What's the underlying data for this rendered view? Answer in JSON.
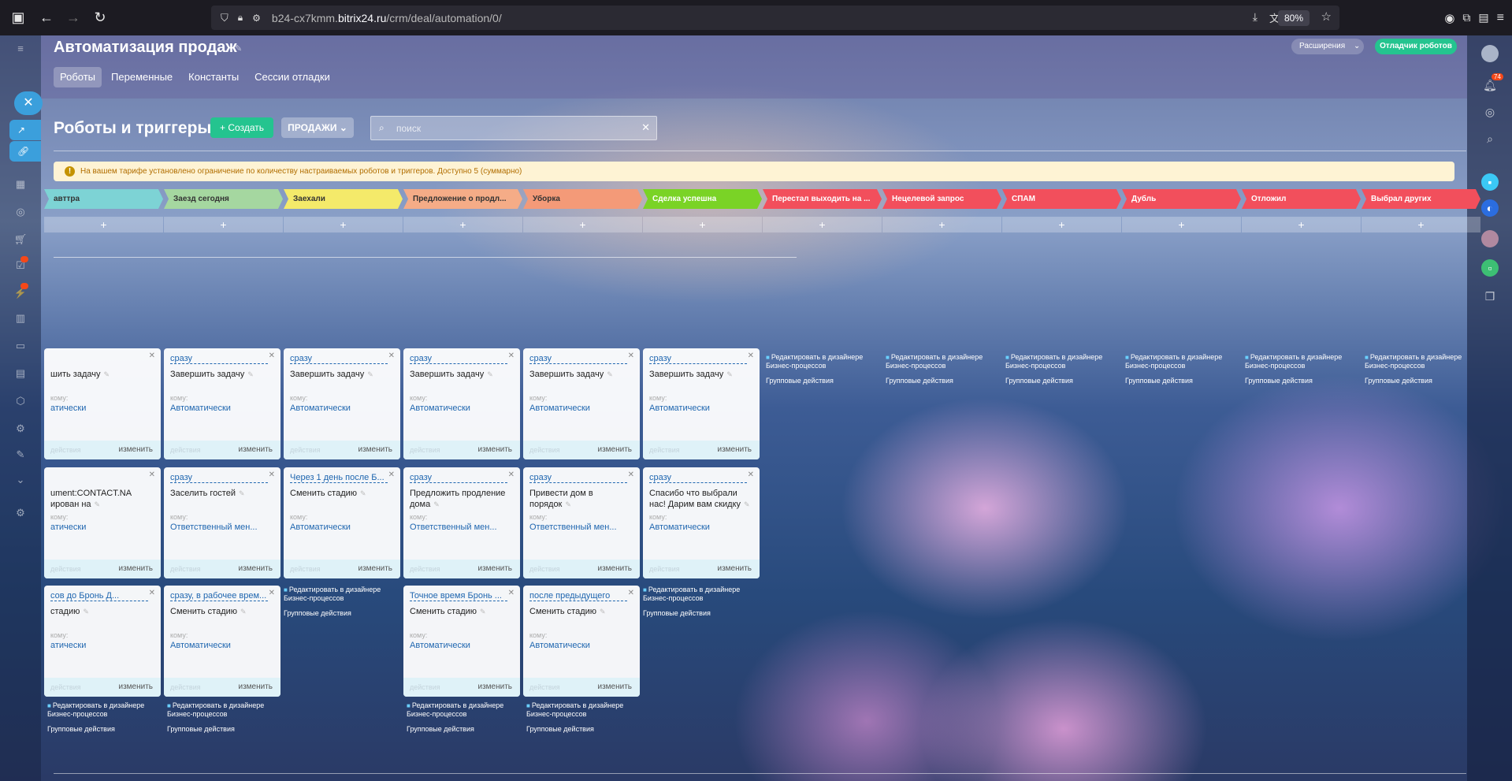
{
  "browser": {
    "url_prefix": "b24-cx7kmm.",
    "url_domain": "bitrix24.ru",
    "url_path": "/crm/deal/automation/0/",
    "zoom": "80%"
  },
  "page": {
    "title": "Автоматизация продаж",
    "extensions_label": "Расширения",
    "debugger_label": "Отладчик роботов",
    "tabs": [
      {
        "label": "Роботы",
        "active": true
      },
      {
        "label": "Переменные",
        "active": false
      },
      {
        "label": "Константы",
        "active": false
      },
      {
        "label": "Сессии отладки",
        "active": false
      }
    ],
    "section_title": "Роботы и триггеры",
    "create_label": "Создать",
    "category_label": "ПРОДАЖИ",
    "search_placeholder": "поиск",
    "notice_text": "На вашем тарифе установлено ограничение по количеству настраиваемых роботов и триггеров. Доступно 5 (суммарно)",
    "right_rail_badge": "74"
  },
  "stages": [
    {
      "label": "авттра",
      "color": "#7dd3d5"
    },
    {
      "label": "Заезд сегодня",
      "color": "#a5d7a0"
    },
    {
      "label": "Заехали",
      "color": "#f4ea6a"
    },
    {
      "label": "Предложение о продл...",
      "color": "#f5ac87"
    },
    {
      "label": "Уборка",
      "color": "#f49a78"
    },
    {
      "label": "Сделка успешна",
      "color": "#7ad326"
    },
    {
      "label": "Перестал выходить на ...",
      "color": "#f24f5c"
    },
    {
      "label": "Нецелевой запрос",
      "color": "#f24f5c"
    },
    {
      "label": "СПАМ",
      "color": "#f24f5c"
    },
    {
      "label": "Дубль",
      "color": "#f24f5c"
    },
    {
      "label": "Отложил",
      "color": "#f24f5c"
    },
    {
      "label": "Выбрал других",
      "color": "#f24f5c"
    }
  ],
  "card_labels": {
    "whom": "кому:",
    "actions": "действия",
    "edit": "изменить",
    "bp_link_1": "Редактировать в дизайнере",
    "bp_link_2": "Бизнес-процессов",
    "group_actions": "Групповые действия"
  },
  "rows": [
    [
      {
        "when": "",
        "title": "шить задачу",
        "resp": "атически"
      },
      {
        "when": "сразу",
        "title": "Завершить задачу",
        "resp": "Автоматически"
      },
      {
        "when": "сразу",
        "title": "Завершить задачу",
        "resp": "Автоматически"
      },
      {
        "when": "сразу",
        "title": "Завершить задачу",
        "resp": "Автоматически"
      },
      {
        "when": "сразу",
        "title": "Завершить задачу",
        "resp": "Автоматически"
      },
      {
        "when": "сразу",
        "title": "Завершить задачу",
        "resp": "Автоматически"
      }
    ],
    [
      {
        "when": "",
        "title": "ument:CONTACT.NA ирован на",
        "resp": "атически"
      },
      {
        "when": "сразу",
        "title": "Заселить гостей",
        "resp": "Ответственный мен..."
      },
      {
        "when": "Через 1 день после Б...",
        "title": "Сменить стадию",
        "resp": "Автоматически"
      },
      {
        "when": "сразу",
        "title": "Предложить продление дома",
        "resp": "Ответственный мен..."
      },
      {
        "when": "сразу",
        "title": "Привести дом в порядок",
        "resp": "Ответственный мен..."
      },
      {
        "when": "сразу",
        "title": "Спасибо что выбрали нас! Дарим вам скидку",
        "resp": "Автоматически"
      }
    ],
    [
      {
        "when": "сов до Бронь Д...",
        "title": "стадию",
        "resp": "атически"
      },
      {
        "when": "сразу, в рабочее врем...",
        "title": "Сменить стадию",
        "resp": "Автоматически"
      },
      null,
      {
        "when": "Точное время Бронь ...",
        "title": "Сменить стадию",
        "resp": "Автоматически"
      },
      {
        "when": "после предыдущего",
        "title": "Сменить стадию",
        "resp": "Автоматически"
      },
      null
    ]
  ]
}
